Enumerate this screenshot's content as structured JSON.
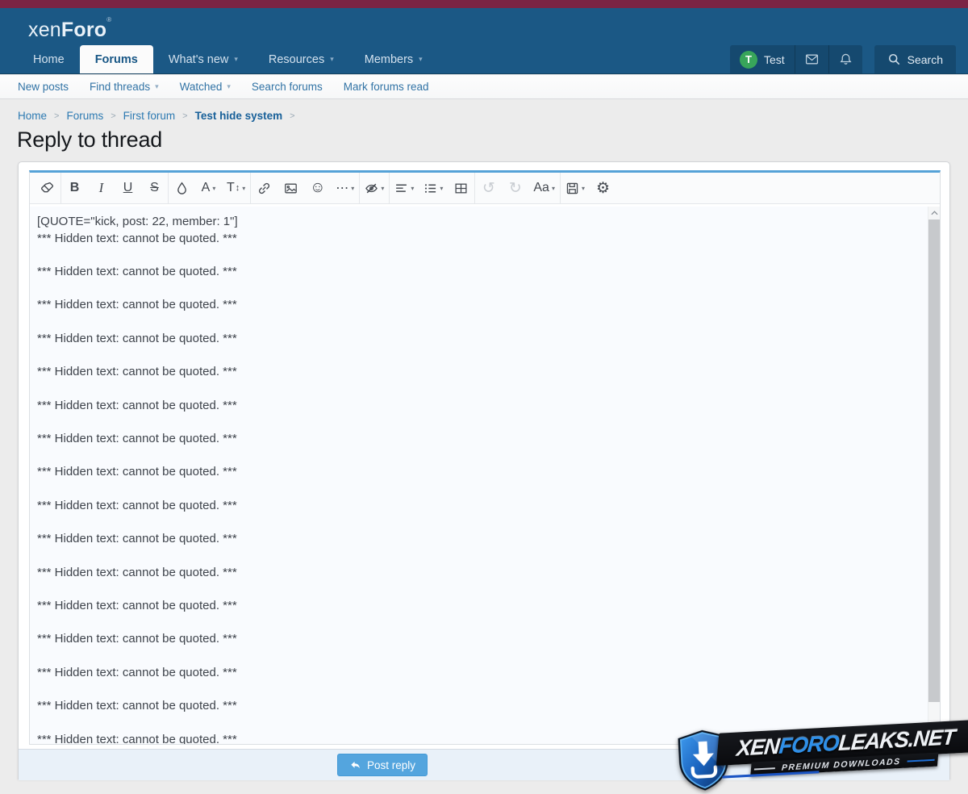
{
  "header": {
    "logo": {
      "light": "xen",
      "bold": "Foro",
      "reg": "®"
    },
    "nav": [
      {
        "label": "Home",
        "caret": false,
        "active": false
      },
      {
        "label": "Forums",
        "caret": false,
        "active": true
      },
      {
        "label": "What's new",
        "caret": true,
        "active": false
      },
      {
        "label": "Resources",
        "caret": true,
        "active": false
      },
      {
        "label": "Members",
        "caret": true,
        "active": false
      }
    ],
    "user": {
      "avatar_initial": "T",
      "name": "Test"
    },
    "search_label": "Search"
  },
  "subnav": [
    {
      "label": "New posts",
      "caret": false
    },
    {
      "label": "Find threads",
      "caret": true
    },
    {
      "label": "Watched",
      "caret": true
    },
    {
      "label": "Search forums",
      "caret": false
    },
    {
      "label": "Mark forums read",
      "caret": false
    }
  ],
  "breadcrumb": {
    "separator": ">",
    "items": [
      {
        "label": "Home",
        "current": false
      },
      {
        "label": "Forums",
        "current": false
      },
      {
        "label": "First forum",
        "current": false
      },
      {
        "label": "Test hide system",
        "current": true
      }
    ]
  },
  "page": {
    "title": "Reply to thread"
  },
  "editor": {
    "toolbar": {
      "groups": [
        [
          {
            "name": "remove-format",
            "icon": "eraser"
          }
        ],
        [
          {
            "name": "bold",
            "glyph": "B",
            "style": "b"
          },
          {
            "name": "italic",
            "glyph": "I",
            "style": "i"
          },
          {
            "name": "underline",
            "glyph": "U",
            "style": "u"
          },
          {
            "name": "strikethrough",
            "glyph": "S",
            "style": "s"
          }
        ],
        [
          {
            "name": "text-color",
            "icon": "droplet"
          },
          {
            "name": "font-family",
            "glyph": "A",
            "caret": true
          },
          {
            "name": "font-size",
            "glyph": "T",
            "extra": "↕",
            "caret": true
          }
        ],
        [
          {
            "name": "insert-link",
            "icon": "link"
          },
          {
            "name": "insert-image",
            "icon": "image"
          },
          {
            "name": "smilies",
            "glyph": "☺",
            "big": true
          },
          {
            "name": "more-options",
            "glyph": "⋯",
            "caret": true
          }
        ],
        [
          {
            "name": "hide-text",
            "icon": "eyeslash",
            "caret": true
          }
        ],
        [
          {
            "name": "text-align",
            "icon": "align",
            "caret": true
          },
          {
            "name": "list",
            "icon": "list",
            "caret": true
          },
          {
            "name": "insert-table",
            "icon": "table"
          }
        ],
        [
          {
            "name": "undo",
            "glyph": "↺",
            "big": true,
            "disabled": true
          },
          {
            "name": "redo",
            "glyph": "↻",
            "big": true,
            "disabled": true
          },
          {
            "name": "preview",
            "glyph": "Aa",
            "caret": true
          }
        ],
        [
          {
            "name": "drafts",
            "icon": "floppy",
            "caret": true
          },
          {
            "name": "editor-settings",
            "glyph": "⚙",
            "big": true
          }
        ]
      ]
    },
    "content": {
      "quote_open": "[QUOTE=\"kick, post: 22, member: 1\"]",
      "hidden_line": "*** Hidden text: cannot be quoted. ***",
      "hidden_count": 16
    }
  },
  "footer": {
    "post_reply_label": "Post reply"
  },
  "watermark": {
    "brand_pre": "XEN",
    "brand_mid": "FORO",
    "brand_post": "LEAKS.NET",
    "tagline": "PREMIUM DOWNLOADS"
  },
  "icons": {
    "caret_glyph": "▾"
  },
  "colors": {
    "topbar": "#7b2444",
    "header": "#1b5885",
    "header_dark": "#15496f",
    "accent_blue": "#54a5de",
    "avatar_green": "#38a55a",
    "editor_accent": "#55a2d7",
    "watermark_blue": "#2e8fe8"
  }
}
